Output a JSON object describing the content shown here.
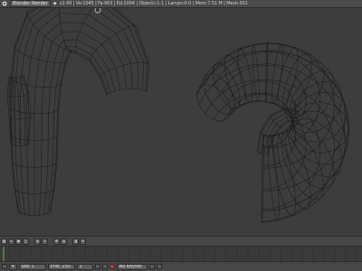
{
  "topbar": {
    "engine": "Blender Render",
    "status": "v2.49 | Ve:1045 | Fa:963 | Ed:2004 | Objects:1-1 | Lamps:0-0 | Mem:7.51 M | Mesh.001"
  },
  "viewport": {
    "header_buttons": [
      "view",
      "select",
      "object",
      "mode",
      "draw",
      "pivot",
      "manip",
      "layers",
      "lock",
      "snap",
      "render"
    ]
  },
  "bottombar": {
    "frame_field": "Sta: 1",
    "end_field": "End: 250",
    "current_frame": "1",
    "keying_set": "No Keyset"
  },
  "colors": {
    "wire": "#1a1a1a",
    "background": "#3d3d3d",
    "record": "#c43c3c"
  }
}
